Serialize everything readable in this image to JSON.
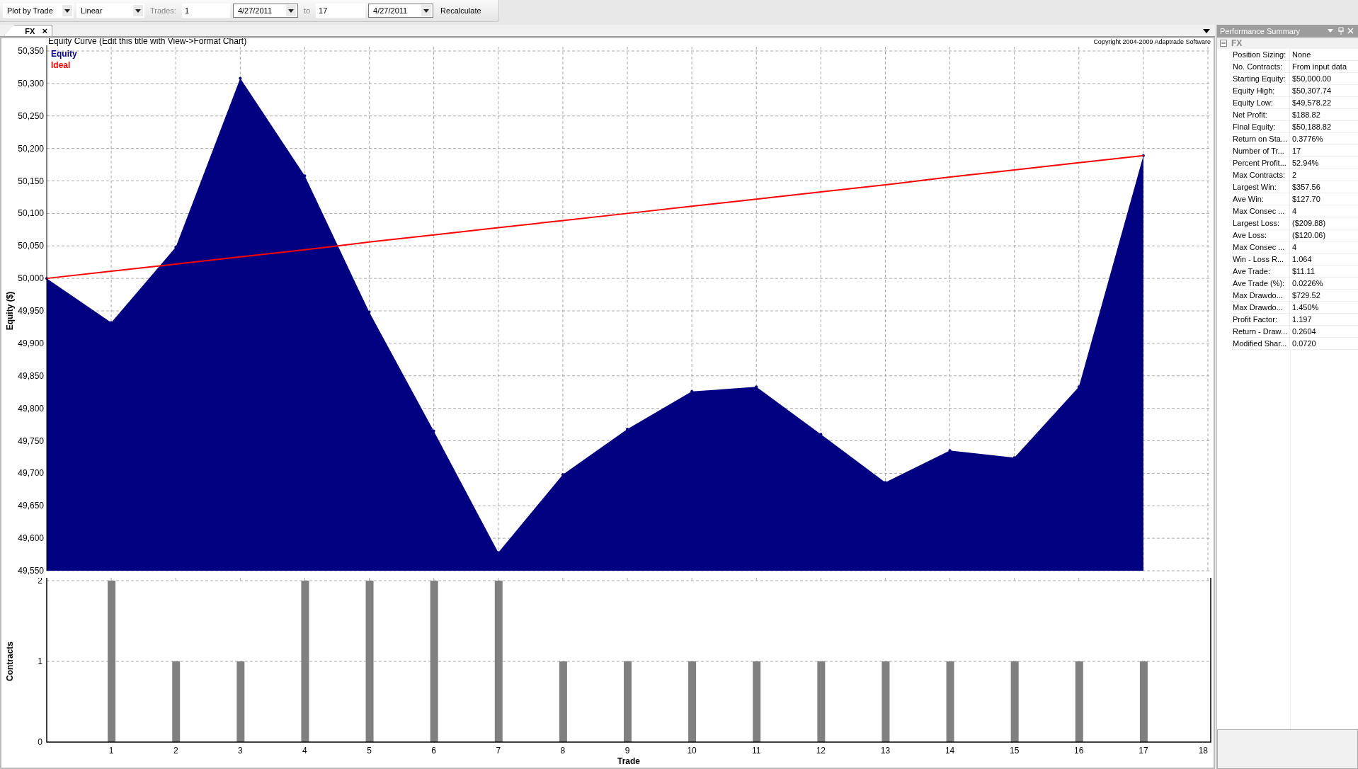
{
  "toolbar": {
    "plot_mode": "Plot by Trade",
    "scale": "Linear",
    "trades_label": "Trades:",
    "from_trade": "1",
    "from_date": "4/27/2011",
    "to_label": "to",
    "to_trade": "17",
    "to_date": "4/27/2011",
    "recalculate": "Recalculate"
  },
  "tabs": [
    {
      "label": "FX",
      "selected": true,
      "close": "×"
    }
  ],
  "chart": {
    "copyright": "Copyright 2004-2009 Adaptrade Software",
    "equity_chart": {
      "chart_data": {
        "type": "area",
        "title": "Equity Curve (Edit this title with View->Format Chart)",
        "ylabel": "Equity ($)",
        "x": [
          0,
          1,
          2,
          3,
          4,
          5,
          6,
          7,
          8,
          9,
          10,
          11,
          12,
          13,
          14,
          15,
          16,
          17
        ],
        "xlim": [
          0,
          18
        ],
        "ylim": [
          49550,
          50350
        ],
        "grid": true,
        "series": [
          {
            "name": "Equity",
            "type": "area",
            "color": "#000080",
            "values": [
              50000,
              49932,
              50048,
              50308,
              50158,
              49948,
              49765,
              49578,
              49698,
              49768,
              49826,
              49833,
              49760,
              49686,
              49735,
              49724,
              49833,
              50189
            ]
          },
          {
            "name": "Ideal",
            "type": "line",
            "color": "#ff0000",
            "values": [
              50000,
              50011,
              50022,
              50033,
              50044,
              50056,
              50067,
              50078,
              50089,
              50100,
              50111,
              50122,
              50133,
              50144,
              50156,
              50167,
              50178,
              50189
            ]
          }
        ],
        "yticks": [
          {
            "value": 49550,
            "label": "49,550"
          },
          {
            "value": 49600,
            "label": "49,600"
          },
          {
            "value": 49650,
            "label": "49,650"
          },
          {
            "value": 49700,
            "label": "49,700"
          },
          {
            "value": 49750,
            "label": "49,750"
          },
          {
            "value": 49800,
            "label": "49,800"
          },
          {
            "value": 49850,
            "label": "49,850"
          },
          {
            "value": 49900,
            "label": "49,900"
          },
          {
            "value": 49950,
            "label": "49,950"
          },
          {
            "value": 50000,
            "label": "50,000"
          },
          {
            "value": 50050,
            "label": "50,050"
          },
          {
            "value": 50100,
            "label": "50,100"
          },
          {
            "value": 50150,
            "label": "50,150"
          },
          {
            "value": 50200,
            "label": "50,200"
          },
          {
            "value": 50250,
            "label": "50,250"
          },
          {
            "value": 50300,
            "label": "50,300"
          },
          {
            "value": 50350,
            "label": "50,350"
          }
        ]
      }
    },
    "contracts_chart": {
      "chart_data": {
        "type": "bar",
        "xlabel": "Trade",
        "ylabel": "Contracts",
        "x": [
          1,
          2,
          3,
          4,
          5,
          6,
          7,
          8,
          9,
          10,
          11,
          12,
          13,
          14,
          15,
          16,
          17
        ],
        "values": [
          2,
          1,
          1,
          2,
          2,
          2,
          2,
          1,
          1,
          1,
          1,
          1,
          1,
          1,
          1,
          1,
          1
        ],
        "xlim": [
          0,
          18
        ],
        "ylim": [
          0,
          2
        ],
        "grid": true,
        "xticks": [
          1,
          2,
          3,
          4,
          5,
          6,
          7,
          8,
          9,
          10,
          11,
          12,
          13,
          14,
          15,
          16,
          17,
          18
        ],
        "yticks": [
          0,
          1,
          2
        ]
      }
    }
  },
  "summary": {
    "title": "Performance Summary",
    "group": {
      "label": "FX",
      "expanded": true,
      "rows": [
        {
          "label": "Position Sizing:",
          "value": "None"
        },
        {
          "label": "No. Contracts:",
          "value": "From input data"
        },
        {
          "label": "Starting Equity:",
          "value": "$50,000.00"
        },
        {
          "label": "Equity High:",
          "value": "$50,307.74"
        },
        {
          "label": "Equity Low:",
          "value": "$49,578.22"
        },
        {
          "label": "Net Profit:",
          "value": "$188.82"
        },
        {
          "label": "Final Equity:",
          "value": "$50,188.82"
        },
        {
          "label": "Return on Sta...",
          "value": "0.3776%"
        },
        {
          "label": "Number of Tr...",
          "value": "17"
        },
        {
          "label": "Percent Profit...",
          "value": "52.94%"
        },
        {
          "label": "Max Contracts:",
          "value": "2"
        },
        {
          "label": "Largest Win:",
          "value": "$357.56"
        },
        {
          "label": "Ave Win:",
          "value": "$127.70"
        },
        {
          "label": "Max Consec ...",
          "value": "4"
        },
        {
          "label": "Largest Loss:",
          "value": "($209.88)"
        },
        {
          "label": "Ave Loss:",
          "value": "($120.06)"
        },
        {
          "label": "Max Consec ...",
          "value": "4"
        },
        {
          "label": "Win - Loss R...",
          "value": "1.064"
        },
        {
          "label": "Ave Trade:",
          "value": "$11.11"
        },
        {
          "label": "Ave Trade (%):",
          "value": "0.0226%"
        },
        {
          "label": "Max Drawdo...",
          "value": "$729.52"
        },
        {
          "label": "Max Drawdo...",
          "value": "1.450%"
        },
        {
          "label": "Profit Factor:",
          "value": "1.197"
        },
        {
          "label": "Return - Draw...",
          "value": "0.2604"
        },
        {
          "label": "Modified Shar...",
          "value": "0.0720"
        }
      ]
    }
  }
}
